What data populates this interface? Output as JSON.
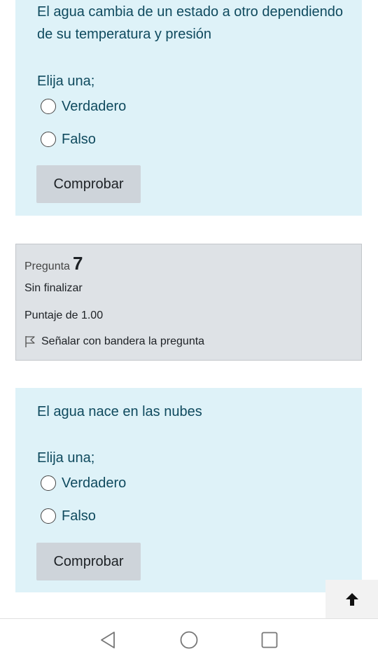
{
  "question6": {
    "text": "El agua cambia de un estado a otro dependiendo de su temperatura y presión",
    "prompt": "Elija una;",
    "options": [
      {
        "label": "Verdadero",
        "selected": false
      },
      {
        "label": "Falso",
        "selected": false
      }
    ],
    "check_label": "Comprobar"
  },
  "question7_info": {
    "label": "Pregunta",
    "number": "7",
    "state": "Sin finalizar",
    "grade": "Puntaje de 1.00",
    "flag_label": "Señalar con bandera la pregunta"
  },
  "question7": {
    "text": "El agua nace en las nubes",
    "prompt": "Elija una;",
    "options": [
      {
        "label": "Verdadero",
        "selected": false
      },
      {
        "label": "Falso",
        "selected": false
      }
    ],
    "check_label": "Comprobar"
  },
  "icons": {
    "back_to_top": "arrow-up-icon",
    "flag": "flag-outline-icon",
    "nav_back": "triangle-back-icon",
    "nav_home": "circle-home-icon",
    "nav_recents": "square-recents-icon"
  },
  "colors": {
    "formulation_bg": "#def2f8",
    "formulation_text": "#0f4a5e",
    "info_bg": "#dee2e6",
    "button_bg": "#ced4da"
  }
}
